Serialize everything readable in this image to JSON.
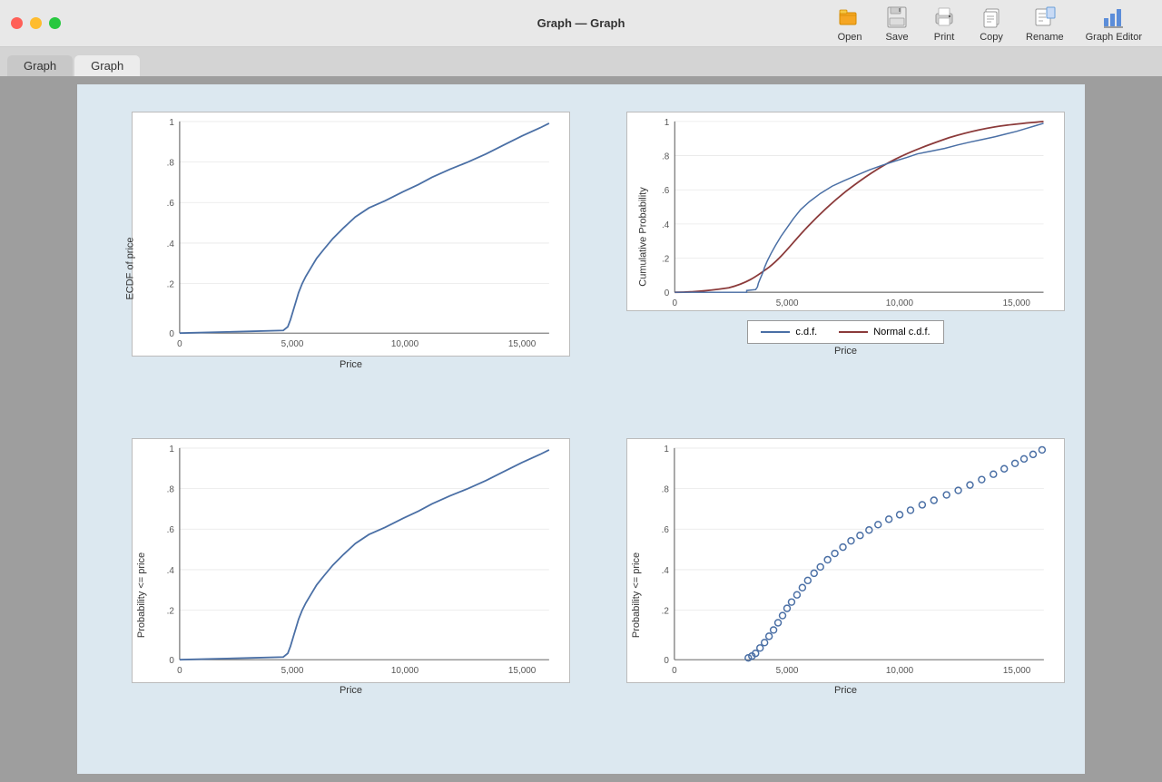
{
  "titlebar": {
    "title": "Graph — Graph",
    "tab1": "Graph",
    "tab2": "Graph"
  },
  "toolbar": {
    "open_label": "Open",
    "save_label": "Save",
    "print_label": "Print",
    "copy_label": "Copy",
    "rename_label": "Rename",
    "graph_editor_label": "Graph Editor"
  },
  "graphs": {
    "top_left": {
      "y_label": "ECDF of price",
      "x_label": "Price",
      "x_ticks": [
        "0",
        "5,000",
        "10,000",
        "15,000"
      ],
      "y_ticks": [
        "0",
        ".2",
        ".4",
        ".6",
        ".8",
        "1"
      ]
    },
    "top_right": {
      "y_label": "Cumulative Probability",
      "x_label": "Price",
      "x_ticks": [
        "0",
        "5,000",
        "10,000",
        "15,000"
      ],
      "y_ticks": [
        "0",
        ".2",
        ".4",
        ".6",
        ".8",
        "1"
      ],
      "legend": {
        "cdf_label": "c.d.f.",
        "normal_label": "Normal c.d.f.",
        "cdf_color": "#4a6fa5",
        "normal_color": "#8b3a3a"
      }
    },
    "bottom_left": {
      "y_label": "Probability <= price",
      "x_label": "Price",
      "x_ticks": [
        "0",
        "5,000",
        "10,000",
        "15,000"
      ],
      "y_ticks": [
        "0",
        ".2",
        ".4",
        ".6",
        ".8",
        "1"
      ]
    },
    "bottom_right": {
      "y_label": "Probability <= price",
      "x_label": "Price",
      "x_ticks": [
        "0",
        "5,000",
        "10,000",
        "15,000"
      ],
      "y_ticks": [
        "0",
        ".2",
        ".4",
        ".6",
        ".8",
        "1"
      ]
    }
  },
  "colors": {
    "ecdf_line": "#4a6fa5",
    "normal_cdf": "#8b3a3a",
    "plot_bg": "#ffffff",
    "grid_line": "#e0e0e0",
    "accent": "#4a6fa5"
  }
}
